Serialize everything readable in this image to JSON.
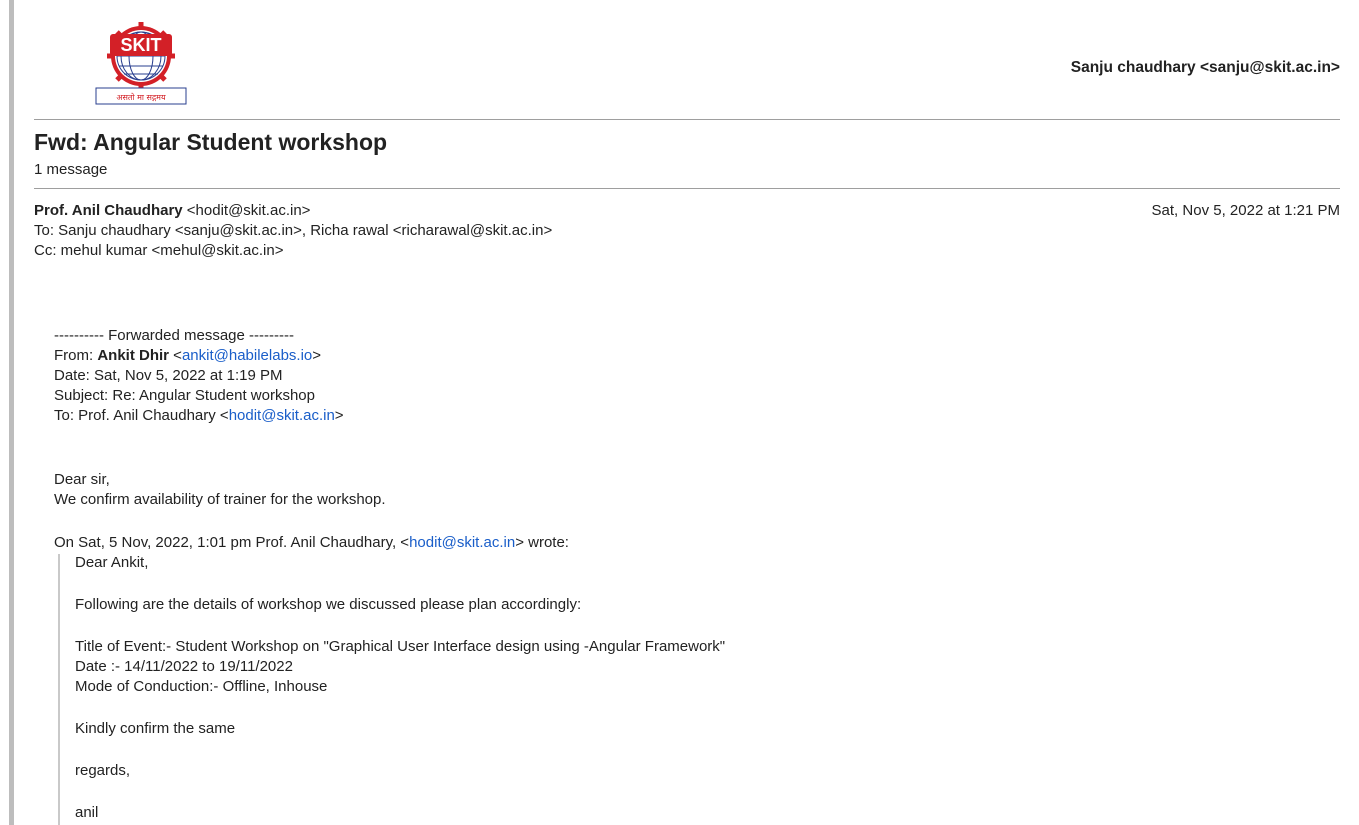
{
  "header": {
    "logo_text": "SKIT",
    "logo_tagline": "असतो मा सद्गमय",
    "account": "Sanju chaudhary <sanju@skit.ac.in>"
  },
  "thread": {
    "subject": "Fwd: Angular Student workshop",
    "count": "1 message"
  },
  "message": {
    "from_name": "Prof. Anil Chaudhary",
    "from_email": " <hodit@skit.ac.in>",
    "date": "Sat, Nov 5, 2022 at 1:21 PM",
    "to": "To: Sanju chaudhary <sanju@skit.ac.in>, Richa rawal <richarawal@skit.ac.in>",
    "cc": "Cc: mehul kumar <mehul@skit.ac.in>"
  },
  "forwarded": {
    "divider": "---------- Forwarded message ---------",
    "from_label": "From: ",
    "from_name": "Ankit Dhir",
    "from_open": " <",
    "from_email": "ankit@habilelabs.io",
    "from_close": ">",
    "date": "Date: Sat, Nov 5, 2022 at 1:19 PM",
    "subject": "Subject: Re: Angular Student workshop",
    "to_label": "To: Prof. Anil Chaudhary <",
    "to_email": "hodit@skit.ac.in",
    "to_close": ">"
  },
  "reply": {
    "greeting": "Dear sir,",
    "body": "We confirm availability of trainer for the workshop."
  },
  "quote": {
    "attribution_pre": "On Sat, 5 Nov, 2022, 1:01 pm Prof. Anil Chaudhary, <",
    "attribution_email": "hodit@skit.ac.in",
    "attribution_post": "> wrote:",
    "greeting": "Dear Ankit,",
    "intro": "Following are the details of workshop we discussed please plan accordingly:",
    "title": "Title of Event:- Student Workshop on \"Graphical User Interface design using -Angular Framework\"",
    "date": "Date :- 14/11/2022 to 19/11/2022",
    "mode": "Mode of Conduction:- Offline, Inhouse",
    "confirm": "Kindly confirm the same",
    "regards": "regards,",
    "signature": "anil"
  },
  "colors": {
    "link": "#1a5ec9",
    "logo_red": "#d32027",
    "logo_blue": "#2a3f8f"
  }
}
